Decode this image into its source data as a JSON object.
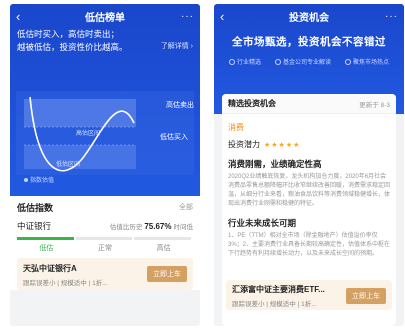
{
  "left": {
    "header": {
      "title": "低估榜单",
      "more": "···"
    },
    "hero": {
      "line1": "低估时买入，高估时卖出；",
      "line2": "越被低估，投资性价比越高。",
      "learn_more": "了解详情 ›",
      "zone_high_label": "高估卖出",
      "zone_low_label": "低估买入",
      "inner_high": "高估区间",
      "inner_low": "低估区间",
      "legend": "指数估值"
    },
    "index_section": {
      "title": "低估指数",
      "all_link": "全部",
      "item": {
        "name": "中证银行",
        "history_label": "估值比历史",
        "percent": "75.67%",
        "time_label": "时间低",
        "levels": [
          "低估",
          "正常",
          "高估"
        ]
      },
      "fund": {
        "name": "天弘中证银行A",
        "sub": "跟踪误差小 | 规模适中 | 1折...",
        "cta": "立即上车"
      }
    }
  },
  "right": {
    "header": {
      "title": "投资机会",
      "more": "···"
    },
    "slogan": "全市场甄选，投资机会不容错过",
    "features": [
      "行业精选",
      "基金公司专业解读",
      "聚焦市场热点"
    ],
    "card": {
      "title": "精选投资机会",
      "updated": "更新于 8-3",
      "tag": "消费",
      "potential_label": "投资潜力",
      "stars": "★★★★★",
      "section1_title": "消费刚需，业绩确定性高",
      "section1_text": "2020Q2业绩触底恢复，龙头机构加仓力度，2020年6月社会消费品零售总额降幅环比收窄继续改善回暖，消费需求稳定回温，从细分行业来看，粮油食品饮料等消费领域稳健增长，体现出消费行业刚需和稳健的特征。",
      "section2_title": "行业未来成长可期",
      "section2_text": "1、PE（TTM）相对全市场（除金融地产）估值溢价率仅3%；2、主要消费行业具备长期较高确定性，估值体系中枢在下行趋势有利持续增长动力，以及未来成长空间的预期。",
      "fund": {
        "name": "汇添富中证主要消费ETF...",
        "sub": "跟踪误差小 | 规模适中 | 1折...",
        "cta": "立即上车"
      }
    }
  },
  "colors": {
    "brand_blue": "#2159e0",
    "gold": "#d4a064",
    "green": "#39b54a",
    "orange": "#e98b16"
  }
}
